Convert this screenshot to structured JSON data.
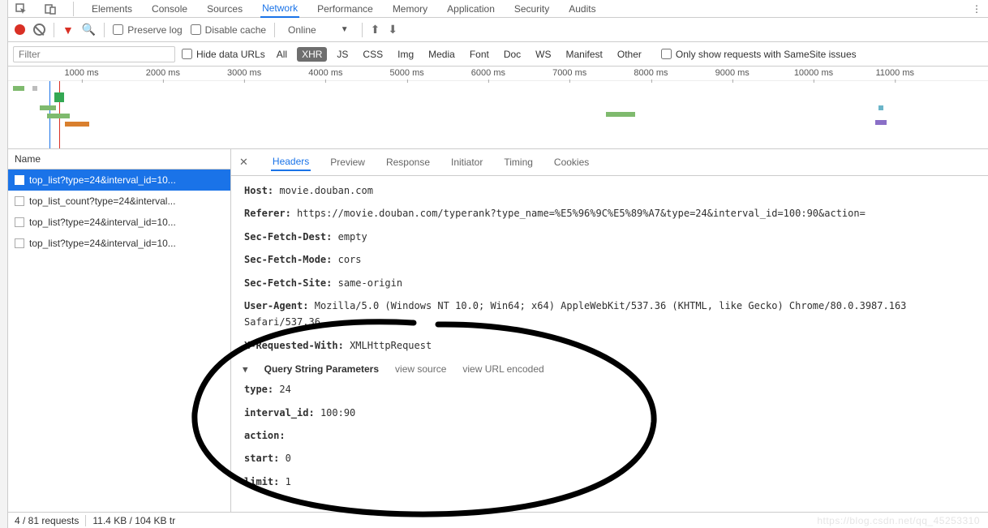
{
  "main_tabs": {
    "items": [
      "Elements",
      "Console",
      "Sources",
      "Network",
      "Performance",
      "Memory",
      "Application",
      "Security",
      "Audits"
    ],
    "active": "Network"
  },
  "toolbar": {
    "preserve_log": "Preserve log",
    "disable_cache": "Disable cache",
    "online": "Online"
  },
  "filterbar": {
    "placeholder": "Filter",
    "hide_data_urls": "Hide data URLs",
    "types": [
      "All",
      "XHR",
      "JS",
      "CSS",
      "Img",
      "Media",
      "Font",
      "Doc",
      "WS",
      "Manifest",
      "Other"
    ],
    "selected_type": "XHR",
    "samesite": "Only show requests with SameSite issues"
  },
  "timeline": {
    "ticks": [
      "1000 ms",
      "2000 ms",
      "3000 ms",
      "4000 ms",
      "5000 ms",
      "6000 ms",
      "7000 ms",
      "8000 ms",
      "9000 ms",
      "10000 ms",
      "11000 ms"
    ]
  },
  "names": {
    "header": "Name",
    "requests": [
      "top_list?type=24&interval_id=10...",
      "top_list_count?type=24&interval...",
      "top_list?type=24&interval_id=10...",
      "top_list?type=24&interval_id=10..."
    ],
    "selected_index": 0
  },
  "details_tabs": {
    "items": [
      "Headers",
      "Preview",
      "Response",
      "Initiator",
      "Timing",
      "Cookies"
    ],
    "active": "Headers"
  },
  "headers": [
    {
      "name": "Host:",
      "value": "movie.douban.com"
    },
    {
      "name": "Referer:",
      "value": "https://movie.douban.com/typerank?type_name=%E5%96%9C%E5%89%A7&type=24&interval_id=100:90&action="
    },
    {
      "name": "Sec-Fetch-Dest:",
      "value": "empty"
    },
    {
      "name": "Sec-Fetch-Mode:",
      "value": "cors"
    },
    {
      "name": "Sec-Fetch-Site:",
      "value": "same-origin"
    },
    {
      "name": "User-Agent:",
      "value": "Mozilla/5.0 (Windows NT 10.0; Win64; x64) AppleWebKit/537.36 (KHTML, like Gecko) Chrome/80.0.3987.163 Safari/537.36"
    },
    {
      "name": "X-Requested-With:",
      "value": "XMLHttpRequest"
    }
  ],
  "query_section": {
    "title": "Query String Parameters",
    "view_source": "view source",
    "view_url_encoded": "view URL encoded",
    "params": [
      {
        "name": "type:",
        "value": "24"
      },
      {
        "name": "interval_id:",
        "value": "100:90"
      },
      {
        "name": "action:",
        "value": ""
      },
      {
        "name": "start:",
        "value": "0"
      },
      {
        "name": "limit:",
        "value": "1"
      }
    ]
  },
  "statusbar": {
    "requests": "4 / 81 requests",
    "transferred": "11.4 KB / 104 KB tr"
  },
  "watermark": "https://blog.csdn.net/qq_45253310"
}
